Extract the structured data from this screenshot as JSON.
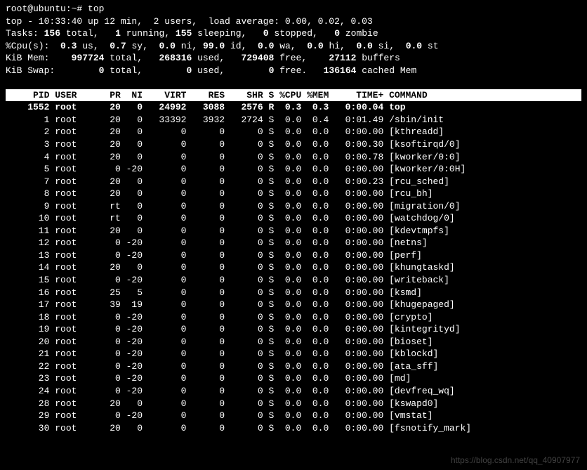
{
  "prompt": "root@ubuntu:~# top",
  "summary": {
    "line1": "top - 10:33:40 up 12 min,  2 users,  load average: 0.00, 0.02, 0.03",
    "tasks": {
      "label": "Tasks:",
      "total": "156",
      "totalLbl": "total,",
      "running": "1",
      "runningLbl": "running,",
      "sleeping": "155",
      "sleepingLbl": "sleeping,",
      "stopped": "0",
      "stoppedLbl": "stopped,",
      "zombie": "0",
      "zombieLbl": "zombie"
    },
    "cpu": {
      "label": "%Cpu(s):",
      "us": "0.3",
      "usLbl": "us,",
      "sy": "0.7",
      "syLbl": "sy,",
      "ni": "0.0",
      "niLbl": "ni,",
      "id": "99.0",
      "idLbl": "id,",
      "wa": "0.0",
      "waLbl": "wa,",
      "hi": "0.0",
      "hiLbl": "hi,",
      "si": "0.0",
      "siLbl": "si,",
      "st": "0.0",
      "stLbl": "st"
    },
    "mem": {
      "label": "KiB Mem:",
      "total": "997724",
      "totalLbl": "total,",
      "used": "268316",
      "usedLbl": "used,",
      "free": "729408",
      "freeLbl": "free,",
      "buffers": "27112",
      "buffersLbl": "buffers"
    },
    "swap": {
      "label": "KiB Swap:",
      "total": "0",
      "totalLbl": "total,",
      "used": "0",
      "usedLbl": "used,",
      "free": "0",
      "freeLbl": "free.",
      "cached": "136164",
      "cachedLbl": "cached Mem"
    }
  },
  "columns": [
    "PID",
    "USER",
    "PR",
    "NI",
    "VIRT",
    "RES",
    "SHR",
    "S",
    "%CPU",
    "%MEM",
    "TIME+",
    "COMMAND"
  ],
  "processes": [
    {
      "pid": "1552",
      "user": "root",
      "pr": "20",
      "ni": "0",
      "virt": "24992",
      "res": "3088",
      "shr": "2576",
      "s": "R",
      "cpu": "0.3",
      "mem": "0.3",
      "time": "0:00.04",
      "cmd": "top",
      "sel": true
    },
    {
      "pid": "1",
      "user": "root",
      "pr": "20",
      "ni": "0",
      "virt": "33392",
      "res": "3932",
      "shr": "2724",
      "s": "S",
      "cpu": "0.0",
      "mem": "0.4",
      "time": "0:01.49",
      "cmd": "/sbin/init"
    },
    {
      "pid": "2",
      "user": "root",
      "pr": "20",
      "ni": "0",
      "virt": "0",
      "res": "0",
      "shr": "0",
      "s": "S",
      "cpu": "0.0",
      "mem": "0.0",
      "time": "0:00.00",
      "cmd": "[kthreadd]"
    },
    {
      "pid": "3",
      "user": "root",
      "pr": "20",
      "ni": "0",
      "virt": "0",
      "res": "0",
      "shr": "0",
      "s": "S",
      "cpu": "0.0",
      "mem": "0.0",
      "time": "0:00.30",
      "cmd": "[ksoftirqd/0]"
    },
    {
      "pid": "4",
      "user": "root",
      "pr": "20",
      "ni": "0",
      "virt": "0",
      "res": "0",
      "shr": "0",
      "s": "S",
      "cpu": "0.0",
      "mem": "0.0",
      "time": "0:00.78",
      "cmd": "[kworker/0:0]"
    },
    {
      "pid": "5",
      "user": "root",
      "pr": "0",
      "ni": "-20",
      "virt": "0",
      "res": "0",
      "shr": "0",
      "s": "S",
      "cpu": "0.0",
      "mem": "0.0",
      "time": "0:00.00",
      "cmd": "[kworker/0:0H]"
    },
    {
      "pid": "7",
      "user": "root",
      "pr": "20",
      "ni": "0",
      "virt": "0",
      "res": "0",
      "shr": "0",
      "s": "S",
      "cpu": "0.0",
      "mem": "0.0",
      "time": "0:00.23",
      "cmd": "[rcu_sched]"
    },
    {
      "pid": "8",
      "user": "root",
      "pr": "20",
      "ni": "0",
      "virt": "0",
      "res": "0",
      "shr": "0",
      "s": "S",
      "cpu": "0.0",
      "mem": "0.0",
      "time": "0:00.00",
      "cmd": "[rcu_bh]"
    },
    {
      "pid": "9",
      "user": "root",
      "pr": "rt",
      "ni": "0",
      "virt": "0",
      "res": "0",
      "shr": "0",
      "s": "S",
      "cpu": "0.0",
      "mem": "0.0",
      "time": "0:00.00",
      "cmd": "[migration/0]"
    },
    {
      "pid": "10",
      "user": "root",
      "pr": "rt",
      "ni": "0",
      "virt": "0",
      "res": "0",
      "shr": "0",
      "s": "S",
      "cpu": "0.0",
      "mem": "0.0",
      "time": "0:00.00",
      "cmd": "[watchdog/0]"
    },
    {
      "pid": "11",
      "user": "root",
      "pr": "20",
      "ni": "0",
      "virt": "0",
      "res": "0",
      "shr": "0",
      "s": "S",
      "cpu": "0.0",
      "mem": "0.0",
      "time": "0:00.00",
      "cmd": "[kdevtmpfs]"
    },
    {
      "pid": "12",
      "user": "root",
      "pr": "0",
      "ni": "-20",
      "virt": "0",
      "res": "0",
      "shr": "0",
      "s": "S",
      "cpu": "0.0",
      "mem": "0.0",
      "time": "0:00.00",
      "cmd": "[netns]"
    },
    {
      "pid": "13",
      "user": "root",
      "pr": "0",
      "ni": "-20",
      "virt": "0",
      "res": "0",
      "shr": "0",
      "s": "S",
      "cpu": "0.0",
      "mem": "0.0",
      "time": "0:00.00",
      "cmd": "[perf]"
    },
    {
      "pid": "14",
      "user": "root",
      "pr": "20",
      "ni": "0",
      "virt": "0",
      "res": "0",
      "shr": "0",
      "s": "S",
      "cpu": "0.0",
      "mem": "0.0",
      "time": "0:00.00",
      "cmd": "[khungtaskd]"
    },
    {
      "pid": "15",
      "user": "root",
      "pr": "0",
      "ni": "-20",
      "virt": "0",
      "res": "0",
      "shr": "0",
      "s": "S",
      "cpu": "0.0",
      "mem": "0.0",
      "time": "0:00.00",
      "cmd": "[writeback]"
    },
    {
      "pid": "16",
      "user": "root",
      "pr": "25",
      "ni": "5",
      "virt": "0",
      "res": "0",
      "shr": "0",
      "s": "S",
      "cpu": "0.0",
      "mem": "0.0",
      "time": "0:00.00",
      "cmd": "[ksmd]"
    },
    {
      "pid": "17",
      "user": "root",
      "pr": "39",
      "ni": "19",
      "virt": "0",
      "res": "0",
      "shr": "0",
      "s": "S",
      "cpu": "0.0",
      "mem": "0.0",
      "time": "0:00.00",
      "cmd": "[khugepaged]"
    },
    {
      "pid": "18",
      "user": "root",
      "pr": "0",
      "ni": "-20",
      "virt": "0",
      "res": "0",
      "shr": "0",
      "s": "S",
      "cpu": "0.0",
      "mem": "0.0",
      "time": "0:00.00",
      "cmd": "[crypto]"
    },
    {
      "pid": "19",
      "user": "root",
      "pr": "0",
      "ni": "-20",
      "virt": "0",
      "res": "0",
      "shr": "0",
      "s": "S",
      "cpu": "0.0",
      "mem": "0.0",
      "time": "0:00.00",
      "cmd": "[kintegrityd]"
    },
    {
      "pid": "20",
      "user": "root",
      "pr": "0",
      "ni": "-20",
      "virt": "0",
      "res": "0",
      "shr": "0",
      "s": "S",
      "cpu": "0.0",
      "mem": "0.0",
      "time": "0:00.00",
      "cmd": "[bioset]"
    },
    {
      "pid": "21",
      "user": "root",
      "pr": "0",
      "ni": "-20",
      "virt": "0",
      "res": "0",
      "shr": "0",
      "s": "S",
      "cpu": "0.0",
      "mem": "0.0",
      "time": "0:00.00",
      "cmd": "[kblockd]"
    },
    {
      "pid": "22",
      "user": "root",
      "pr": "0",
      "ni": "-20",
      "virt": "0",
      "res": "0",
      "shr": "0",
      "s": "S",
      "cpu": "0.0",
      "mem": "0.0",
      "time": "0:00.00",
      "cmd": "[ata_sff]"
    },
    {
      "pid": "23",
      "user": "root",
      "pr": "0",
      "ni": "-20",
      "virt": "0",
      "res": "0",
      "shr": "0",
      "s": "S",
      "cpu": "0.0",
      "mem": "0.0",
      "time": "0:00.00",
      "cmd": "[md]"
    },
    {
      "pid": "24",
      "user": "root",
      "pr": "0",
      "ni": "-20",
      "virt": "0",
      "res": "0",
      "shr": "0",
      "s": "S",
      "cpu": "0.0",
      "mem": "0.0",
      "time": "0:00.00",
      "cmd": "[devfreq_wq]"
    },
    {
      "pid": "28",
      "user": "root",
      "pr": "20",
      "ni": "0",
      "virt": "0",
      "res": "0",
      "shr": "0",
      "s": "S",
      "cpu": "0.0",
      "mem": "0.0",
      "time": "0:00.00",
      "cmd": "[kswapd0]"
    },
    {
      "pid": "29",
      "user": "root",
      "pr": "0",
      "ni": "-20",
      "virt": "0",
      "res": "0",
      "shr": "0",
      "s": "S",
      "cpu": "0.0",
      "mem": "0.0",
      "time": "0:00.00",
      "cmd": "[vmstat]"
    },
    {
      "pid": "30",
      "user": "root",
      "pr": "20",
      "ni": "0",
      "virt": "0",
      "res": "0",
      "shr": "0",
      "s": "S",
      "cpu": "0.0",
      "mem": "0.0",
      "time": "0:00.00",
      "cmd": "[fsnotify_mark]"
    }
  ],
  "watermark": "https://blog.csdn.net/qq_40907977"
}
